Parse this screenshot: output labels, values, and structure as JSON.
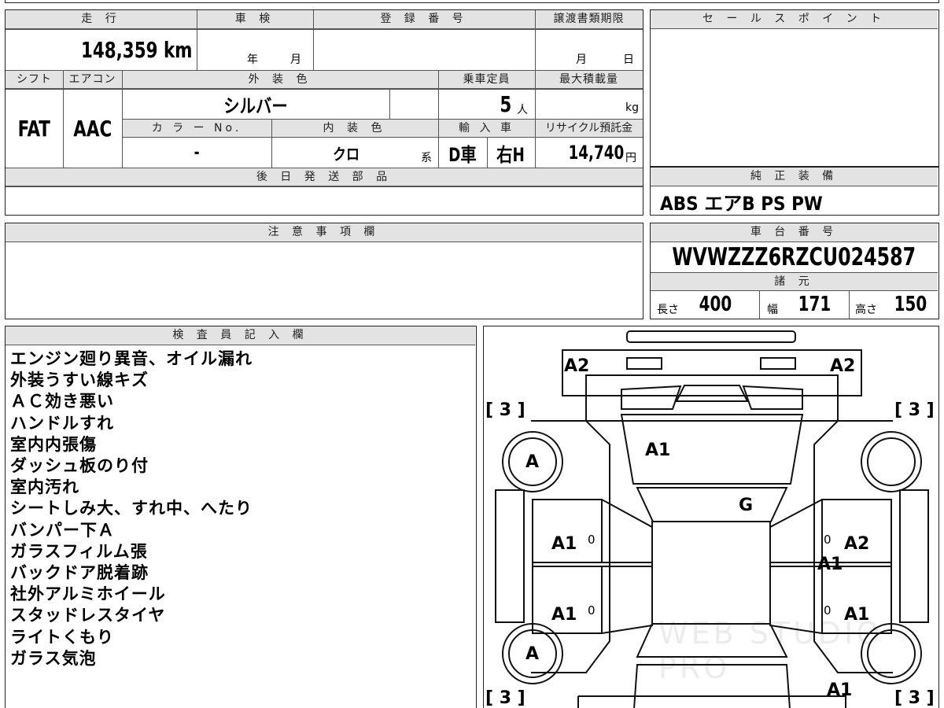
{
  "mileage": {
    "label": "走 行",
    "value": "148,359 km"
  },
  "inspection": {
    "label": "車 検",
    "year": "年",
    "month": "月"
  },
  "registration": {
    "label": "登 録 番 号",
    "value": ""
  },
  "transfer_deadline": {
    "label": "譲渡書類期限",
    "month": "月",
    "day": "日"
  },
  "shift": {
    "label": "シフト",
    "value": "FAT"
  },
  "aircon": {
    "label": "エアコン",
    "value": "AAC"
  },
  "exterior_color": {
    "label": "外 装 色",
    "value": "シルバー"
  },
  "color_no": {
    "label": "カ ラ ー No.",
    "value": "-"
  },
  "interior_color": {
    "label": "内 装 色",
    "value": "クロ",
    "suffix": "系"
  },
  "capacity": {
    "label": "乗車定員",
    "value": "5",
    "unit": "人"
  },
  "max_load": {
    "label": "最大積載量",
    "unit": "kg"
  },
  "import": {
    "label": "輸 入 車",
    "type": "D車",
    "handle": "右H"
  },
  "recycle": {
    "label": "リサイクル預託金",
    "value": "14,740",
    "unit": "円"
  },
  "later_parts": {
    "label": "後 日 発 送 部 品"
  },
  "sales_point": {
    "label": "セ ー ル ス ポ イ ン ト"
  },
  "equipment": {
    "label": "純 正 装 備",
    "value": "ABS エアB PS PW"
  },
  "caution": {
    "label": "注 意 事 項 欄"
  },
  "chassis": {
    "label": "車 台 番 号",
    "value": "WVWZZZ6RZCU024587"
  },
  "specs": {
    "label": "諸 元",
    "length_label": "長さ",
    "length": "400",
    "width_label": "幅",
    "width": "171",
    "height_label": "高さ",
    "height": "150"
  },
  "inspector": {
    "label": "検 査 員 記 入 欄",
    "notes": [
      "エンジン廻り異音、オイル漏れ",
      "外装うすい線キズ",
      "ＡＣ効き悪い",
      "ハンドルすれ",
      "室内内張傷",
      "ダッシュ板のり付",
      "室内汚れ",
      "シートしみ大、すれ中、へたり",
      "バンパー下Ａ",
      "ガラスフィルム張",
      "バックドア脱着跡",
      "社外アルミホイール",
      "スタッドレスタイヤ",
      "ライトくもり",
      "ガラス気泡"
    ]
  },
  "diagram": {
    "marks": {
      "front_left": "A2",
      "front_right": "A2",
      "windshield": "A1",
      "roof": "G",
      "left_front_door": "A1",
      "left_rear_door": "A1",
      "right_front_door": "A2",
      "right_center": "A1",
      "right_rear_door": "A1",
      "wheel_front_left": "A",
      "wheel_rear_left": "A",
      "rear_right": "A1",
      "zero_1": "0",
      "zero_2": "0",
      "zero_3": "0",
      "zero_4": "0"
    },
    "tires": {
      "tl": "[ 3 ]",
      "tr": "[ 3 ]",
      "bl": "[ 3 ]",
      "br": "[ 3 ]"
    },
    "watermark": "WEB STUDIO PRO"
  }
}
